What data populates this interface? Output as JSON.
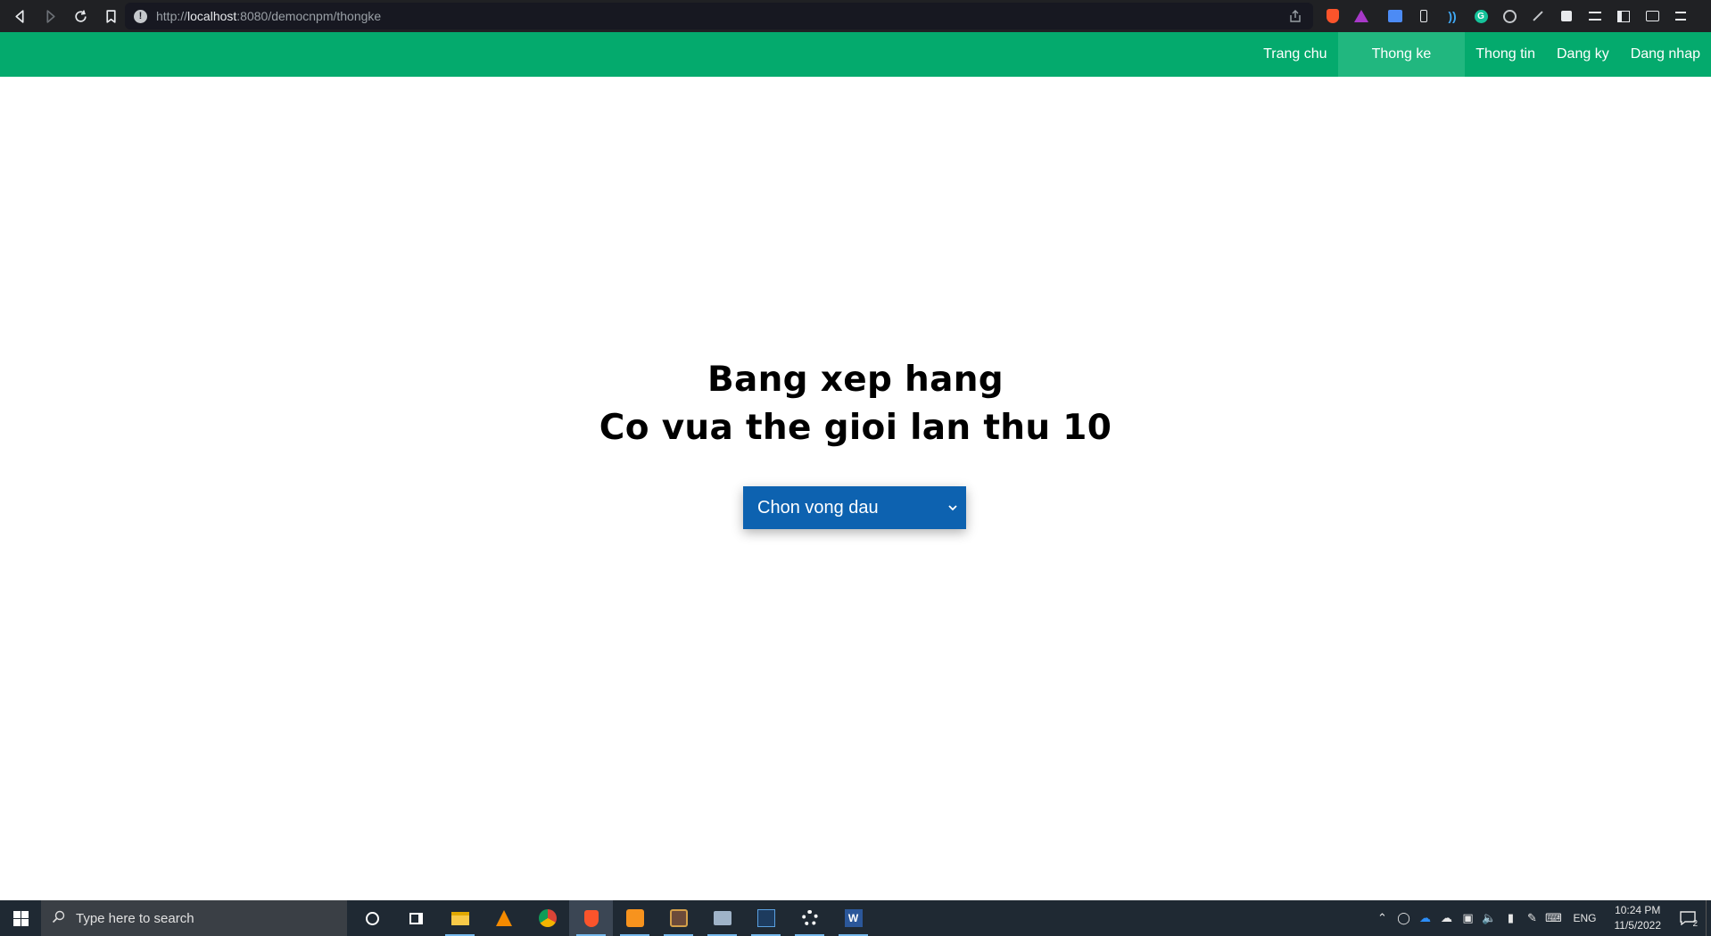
{
  "browser": {
    "url_prefix": "http://",
    "url_host": "localhost",
    "url_rest": ":8080/democnpm/thongke",
    "extensions": [
      "brave-shield-icon",
      "brave-rewards-icon",
      "translate-icon",
      "phone-icon",
      "sound-icon",
      "grammarly-icon",
      "record-icon",
      "pen-icon",
      "puzzle-icon",
      "playlist-icon",
      "sidebar-icon",
      "wallet-icon",
      "menu-icon"
    ]
  },
  "nav": {
    "items": [
      {
        "label": "Trang chu"
      },
      {
        "label": "Thong ke"
      },
      {
        "label": "Thong tin"
      },
      {
        "label": "Dang ky"
      },
      {
        "label": "Dang nhap"
      }
    ],
    "active_index": 1
  },
  "main": {
    "title_line1": "Bang xep hang",
    "title_line2": "Co vua the gioi lan thu 10",
    "round_select": {
      "selected": "Chon vong dau"
    }
  },
  "taskbar": {
    "search_placeholder": "Type here to search",
    "language": "ENG",
    "time": "10:24 PM",
    "date": "11/5/2022",
    "notification_count": "2"
  },
  "colors": {
    "nav_bg": "#04aa6d",
    "nav_active": "#21b77f",
    "select_bg": "#0d62b0"
  }
}
